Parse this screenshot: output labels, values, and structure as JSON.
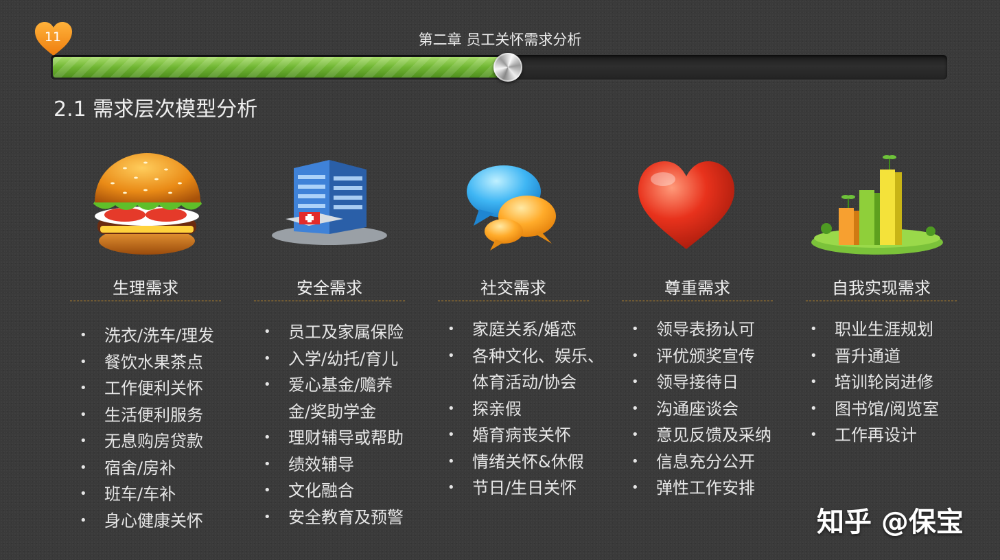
{
  "header": {
    "page_number": "11",
    "chapter_title": "第二章  员工关怀需求分析",
    "progress": 0.51
  },
  "section_title": "2.1  需求层次模型分析",
  "columns": [
    {
      "title": "生理需求",
      "icon": "hamburger-icon",
      "items": [
        "洗衣/洗车/理发",
        "餐饮水果茶点",
        "工作便利关怀",
        "生活便利服务",
        "无息购房贷款",
        "宿舍/房补",
        "班车/车补",
        "身心健康关怀"
      ]
    },
    {
      "title": "安全需求",
      "icon": "hospital-building-icon",
      "items": [
        "员工及家属保险",
        "入学/幼托/育儿",
        "爱心基金/赡养",
        "金/奖助学金",
        "理财辅导或帮助",
        "绩效辅导",
        "文化融合",
        "安全教育及预警"
      ]
    },
    {
      "title": "社交需求",
      "icon": "chat-bubbles-icon",
      "items": [
        "家庭关系/婚恋",
        "各种文化、娱乐、",
        "体育活动/协会",
        "探亲假",
        "婚育病丧关怀",
        "情绪关怀&休假",
        "节日/生日关怀"
      ]
    },
    {
      "title": "尊重需求",
      "icon": "heart-icon",
      "items": [
        "领导表扬认可",
        "评优颁奖宣传",
        "领导接待日",
        "沟通座谈会",
        "意见反馈及采纳",
        "信息充分公开",
        "弹性工作安排"
      ]
    },
    {
      "title": "自我实现需求",
      "icon": "growth-bar-chart-icon",
      "items": [
        "职业生涯规划",
        "晋升通道",
        "培训轮岗进修",
        "图书馆/阅览室",
        "工作再设计"
      ]
    }
  ],
  "watermark": "知乎 @保宝"
}
